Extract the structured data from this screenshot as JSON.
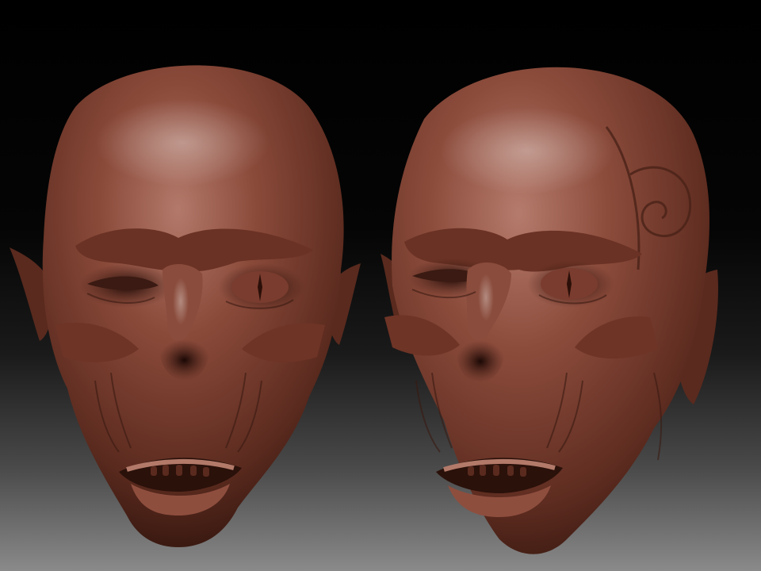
{
  "scene": {
    "subject": "sculpted-head-render",
    "heads": [
      {
        "id": "front",
        "view": "front",
        "icon": "sculpted-head-front"
      },
      {
        "id": "three-quarter",
        "view": "three-quarter",
        "icon": "sculpted-head-three-quarter"
      }
    ],
    "colors": {
      "clay": "#6e3a2c",
      "clay_light": "#a8695a",
      "clay_dark": "#3a1a12",
      "background_top": "#000000",
      "background_bottom": "#8a8a8a"
    }
  }
}
